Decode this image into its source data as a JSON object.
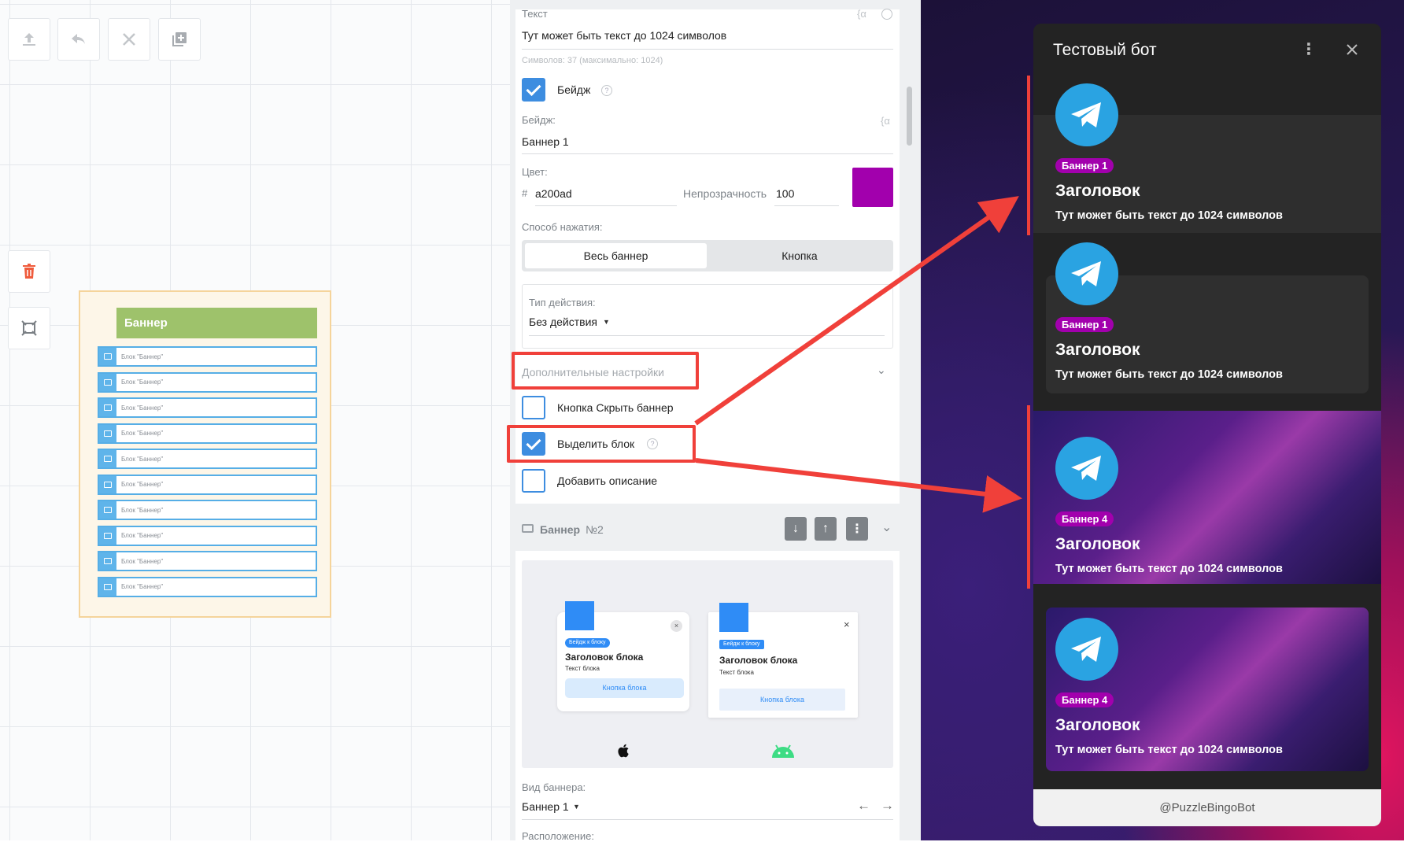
{
  "toolbar": {
    "upload": "upload-icon",
    "undo": "undo-icon",
    "close": "close-icon",
    "duplicate": "duplicate-icon"
  },
  "canvas": {
    "node_title": "Баннер",
    "blocks": [
      "Блок \"Баннер\"",
      "Блок \"Баннер\"",
      "Блок \"Баннер\"",
      "Блок \"Баннер\"",
      "Блок \"Баннер\"",
      "Блок \"Баннер\"",
      "Блок \"Баннер\"",
      "Блок \"Баннер\"",
      "Блок \"Баннер\"",
      "Блок \"Баннер\""
    ]
  },
  "panel": {
    "text_label": "Текст",
    "text_value": "Тут может быть текст до 1024 символов",
    "char_counter": "Символов: 37 (максимально: 1024)",
    "badge_checkbox_label": "Бейдж",
    "badge_label": "Бейдж:",
    "badge_value": "Баннер 1",
    "color_label": "Цвет:",
    "hash": "#",
    "color_value": "a200ad",
    "opacity_label": "Непрозрачность",
    "opacity_value": "100",
    "swatch_color": "#a200ad",
    "press_method_label": "Способ нажатия:",
    "press_option_1": "Весь баннер",
    "press_option_2": "Кнопка",
    "action_type_label": "Тип действия:",
    "action_type_value": "Без действия",
    "advanced_settings": "Дополнительные настройки",
    "hide_button_label": "Кнопка Скрыть баннер",
    "highlight_label": "Выделить блок",
    "add_description_label": "Добавить описание",
    "banner2_title": "Баннер",
    "banner2_number": "№2",
    "preview": {
      "ios_badge": "Бейдж к блоку",
      "ios_title": "Заголовок блока",
      "ios_text": "Текст блока",
      "ios_button": "Кнопка блока",
      "android_badge": "Бейдж к блоку",
      "android_title": "Заголовок блока",
      "android_text": "Текст блока",
      "android_button": "Кнопка блока"
    },
    "banner_view_label": "Вид баннера:",
    "banner_view_value": "Баннер 1",
    "location_label": "Расположение:"
  },
  "telegram": {
    "title": "Тестовый бот",
    "banners": [
      {
        "badge": "Баннер 1",
        "title": "Заголовок",
        "text": "Тут может быть текст до 1024 символов"
      },
      {
        "badge": "Баннер 1",
        "title": "Заголовок",
        "text": "Тут может быть текст до 1024 символов"
      },
      {
        "badge": "Баннер 4",
        "title": "Заголовок",
        "text": "Тут может быть текст до 1024 символов"
      },
      {
        "badge": "Баннер 4",
        "title": "Заголовок",
        "text": "Тут может быть текст до 1024 символов"
      }
    ],
    "footer": "@PuzzleBingoBot"
  },
  "colors": {
    "accent": "#3d8de0",
    "highlight": "#f0403a",
    "badge": "#a200ad",
    "telegram": "#2aa3e2"
  }
}
